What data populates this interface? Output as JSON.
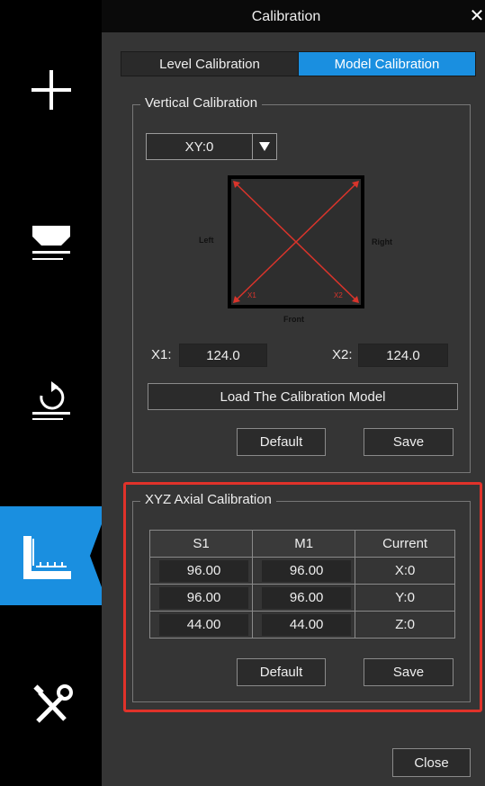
{
  "window": {
    "title": "Calibration"
  },
  "sidebar": {
    "items": [
      {
        "name": "add",
        "icon": "plus-icon"
      },
      {
        "name": "level",
        "icon": "platform-icon"
      },
      {
        "name": "rotate",
        "icon": "rotate-icon"
      },
      {
        "name": "calibration",
        "icon": "ruler-icon",
        "active": true
      },
      {
        "name": "tools",
        "icon": "tools-icon"
      }
    ]
  },
  "tabs": [
    {
      "label": "Level Calibration",
      "active": false
    },
    {
      "label": "Model Calibration",
      "active": true
    }
  ],
  "vertical": {
    "title": "Vertical Calibration",
    "select_value": "XY:0",
    "diagram": {
      "left": "Left",
      "right": "Right",
      "front": "Front",
      "x1": "X1",
      "x2": "X2"
    },
    "x1_label": "X1:",
    "x1_value": "124.0",
    "x2_label": "X2:",
    "x2_value": "124.0",
    "load_button": "Load The Calibration Model",
    "default_button": "Default",
    "save_button": "Save"
  },
  "xyz": {
    "title": "XYZ Axial Calibration",
    "headers": [
      "S1",
      "M1",
      "Current"
    ],
    "rows": [
      {
        "s1": "96.00",
        "m1": "96.00",
        "current": "X:0"
      },
      {
        "s1": "96.00",
        "m1": "96.00",
        "current": "Y:0"
      },
      {
        "s1": "44.00",
        "m1": "44.00",
        "current": "Z:0"
      }
    ],
    "default_button": "Default",
    "save_button": "Save"
  },
  "footer": {
    "close_button": "Close"
  },
  "colors": {
    "accent": "#1a8fe0",
    "highlight": "#e0322a",
    "panel": "#353535",
    "diagram_lines": "#d9342b"
  }
}
